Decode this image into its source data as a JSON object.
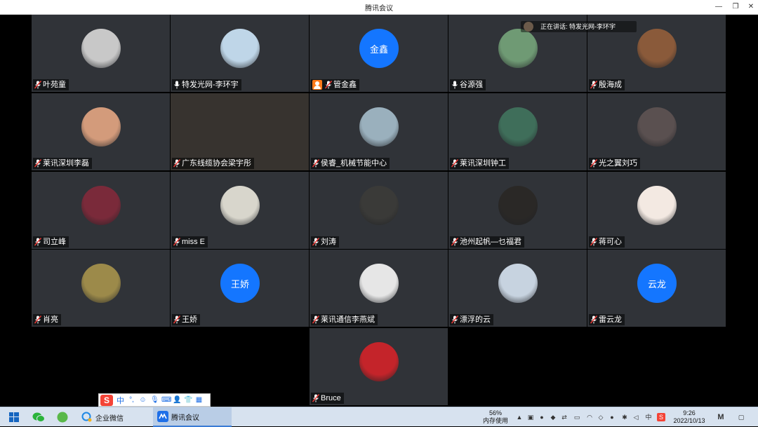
{
  "window": {
    "title": "腾讯会议",
    "minimize": "—",
    "restore": "❐",
    "close": "✕"
  },
  "speaking": {
    "label": "正在讲话:",
    "name": "特发光网-李环宇"
  },
  "participants": [
    {
      "name": "叶苑童",
      "mic": "muted",
      "avatar": "photo",
      "color": "#c8c8c8"
    },
    {
      "name": "特发光网-李环宇",
      "mic": "on",
      "avatar": "photo",
      "color": "#bfd6e8"
    },
    {
      "name": "管金鑫",
      "mic": "muted",
      "host": true,
      "avatar": "text",
      "avatar_text": "金鑫"
    },
    {
      "name": "谷源强",
      "mic": "on",
      "avatar": "photo",
      "color": "#6f9a74"
    },
    {
      "name": "殷海成",
      "mic": "muted",
      "avatar": "photo",
      "color": "#8a5a3a"
    },
    {
      "name": "莱讯深圳李磊",
      "mic": "muted",
      "avatar": "photo",
      "color": "#d39b7b"
    },
    {
      "name": "广东线缆协会梁宇彤",
      "mic": "muted",
      "avatar": "none"
    },
    {
      "name": "侯睿_机械节能中心",
      "mic": "muted",
      "avatar": "photo",
      "color": "#9ab0bd"
    },
    {
      "name": "莱讯深圳钟工",
      "mic": "muted",
      "avatar": "photo",
      "color": "#3f6e5a"
    },
    {
      "name": "光之翼刘巧",
      "mic": "muted",
      "avatar": "photo",
      "color": "#5a5050"
    },
    {
      "name": "司立峰",
      "mic": "muted",
      "avatar": "photo",
      "color": "#7a2a3a"
    },
    {
      "name": "miss E",
      "mic": "muted",
      "avatar": "photo",
      "color": "#d8d6cc"
    },
    {
      "name": "刘涛",
      "mic": "muted",
      "avatar": "photo",
      "color": "#3a3a38"
    },
    {
      "name": "池州起帆—乜福君",
      "mic": "muted",
      "avatar": "photo",
      "color": "#2a2826"
    },
    {
      "name": "蒋可心",
      "mic": "muted",
      "avatar": "photo",
      "color": "#f3e9e2"
    },
    {
      "name": "肖亮",
      "mic": "muted",
      "avatar": "photo",
      "color": "#9c8a4a"
    },
    {
      "name": "王娇",
      "mic": "muted",
      "avatar": "text",
      "avatar_text": "王娇"
    },
    {
      "name": "莱讯通信李燕斌",
      "mic": "muted",
      "avatar": "photo",
      "color": "#e6e6e6"
    },
    {
      "name": "漂浮的云",
      "mic": "muted",
      "avatar": "photo",
      "color": "#c7d3e0"
    },
    {
      "name": "雷云龙",
      "mic": "muted",
      "avatar": "text",
      "avatar_text": "云龙"
    },
    {
      "name": "Bruce",
      "mic": "muted",
      "avatar": "photo",
      "color": "#c4242a"
    }
  ],
  "ime": {
    "logo": "S",
    "mode": "中"
  },
  "taskbar": {
    "apps": [
      {
        "label": "企业微信",
        "icon": "wecom-icon"
      },
      {
        "label": "腾讯会议",
        "icon": "tencent-meeting-icon",
        "active": true
      }
    ],
    "memory": {
      "percent": "56%",
      "label": "内存使用"
    },
    "ime_indicator": "中",
    "time": "9:26",
    "date": "2022/10/13"
  }
}
